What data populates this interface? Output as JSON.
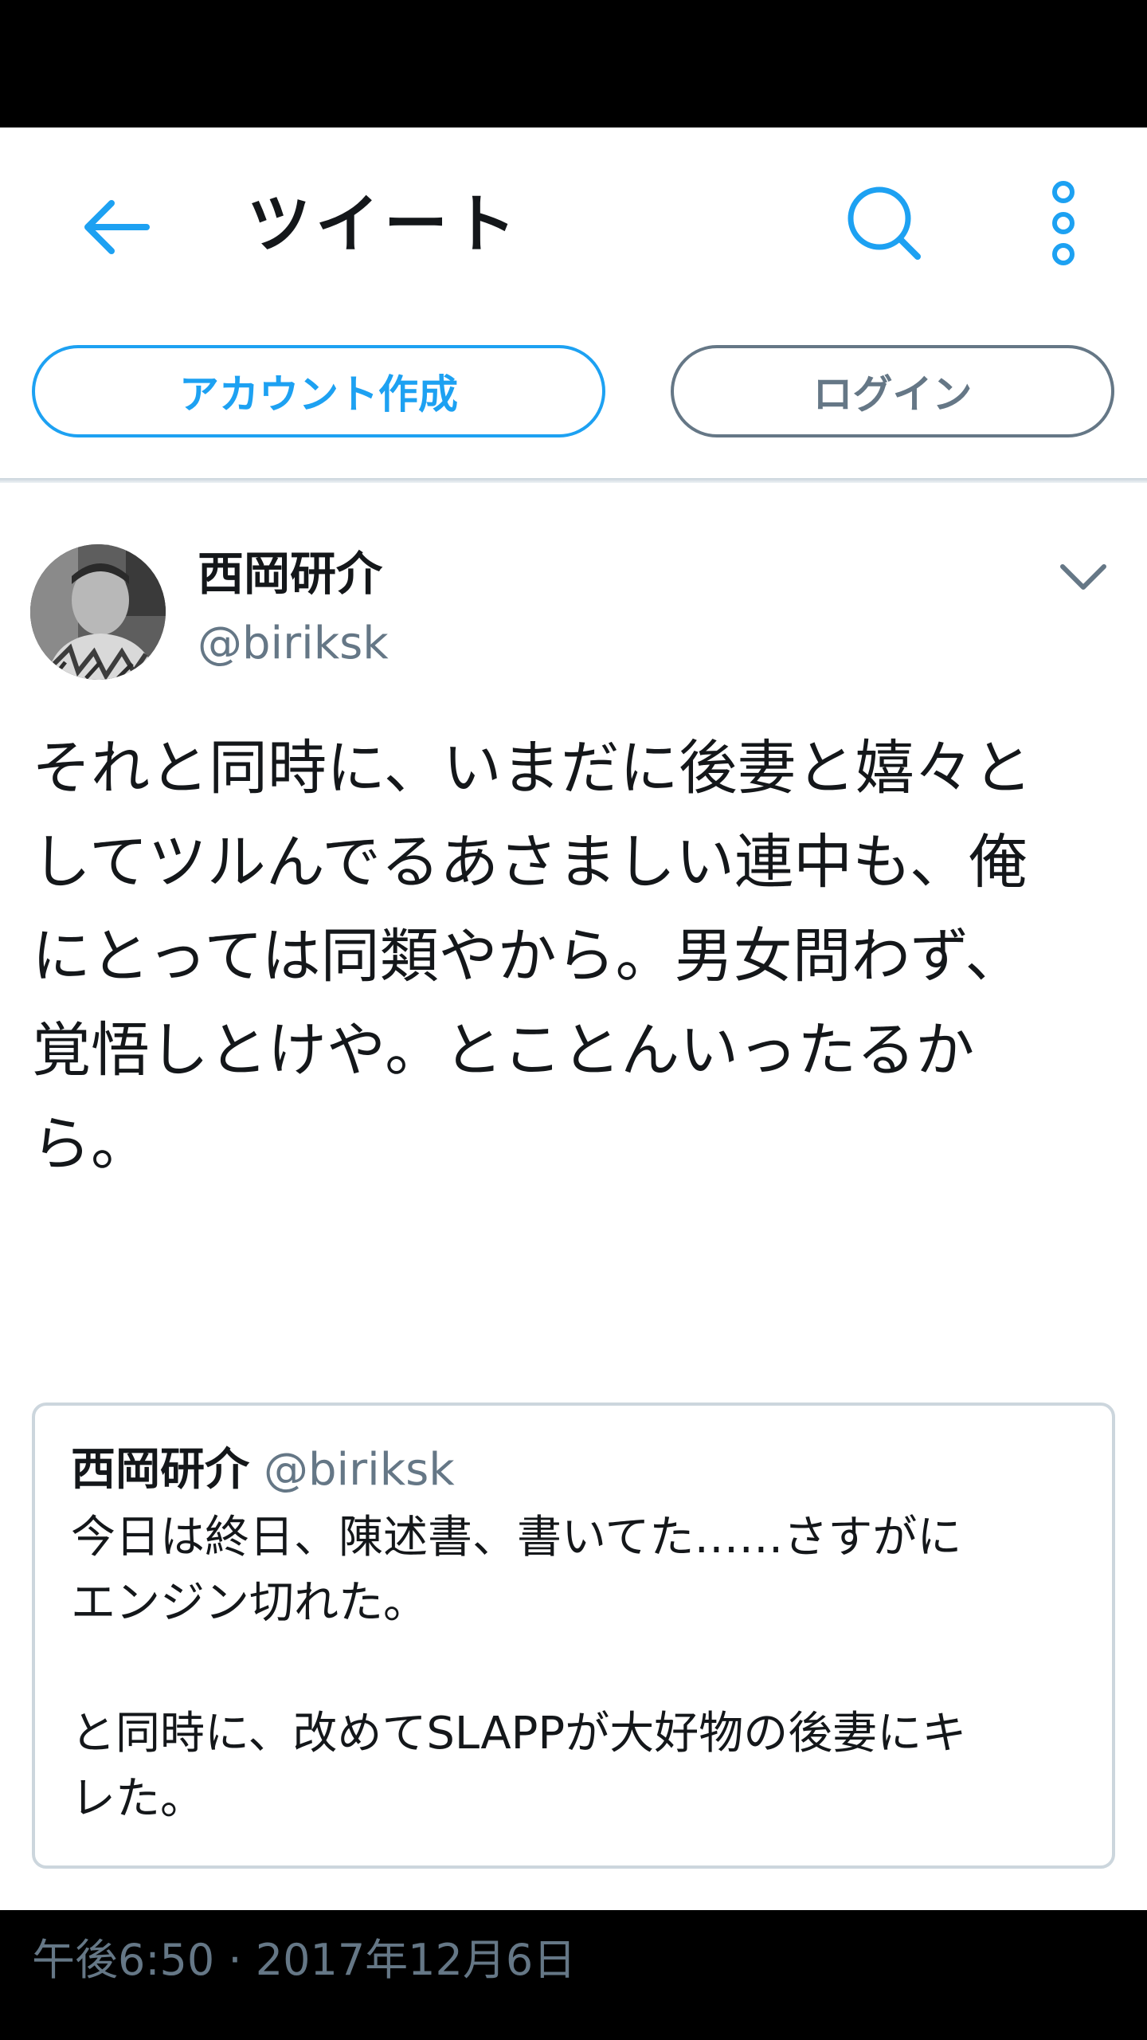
{
  "header": {
    "title": "ツイート",
    "back_icon": "arrow-left-icon",
    "search_icon": "search-icon",
    "more_icon": "more-vertical-icon",
    "accent_color": "#1da1f2"
  },
  "auth": {
    "create_account_label": "アカウント作成",
    "login_label": "ログイン"
  },
  "tweet": {
    "author_name": "西岡研介",
    "author_handle": "@biriksk",
    "avatar": "avatar-photo",
    "menu_icon": "chevron-down-icon",
    "text": "それと同時に、いまだに後妻と嬉々と\nしてツルんでるあさましい連中も、俺\nにとっては同類やから。男女問わず、\n覚悟しとけや。とことんいったるか\nら。",
    "timestamp": "午後6:50 · 2017年12月6日"
  },
  "quoted_tweet": {
    "author_name": "西岡研介",
    "author_handle": "@biriksk",
    "text": "今日は終日、陳述書、書いてた……さすがに\nエンジン切れた。\n\nと同時に、改めてSLAPPが大好物の後妻にキ\nレた。"
  }
}
